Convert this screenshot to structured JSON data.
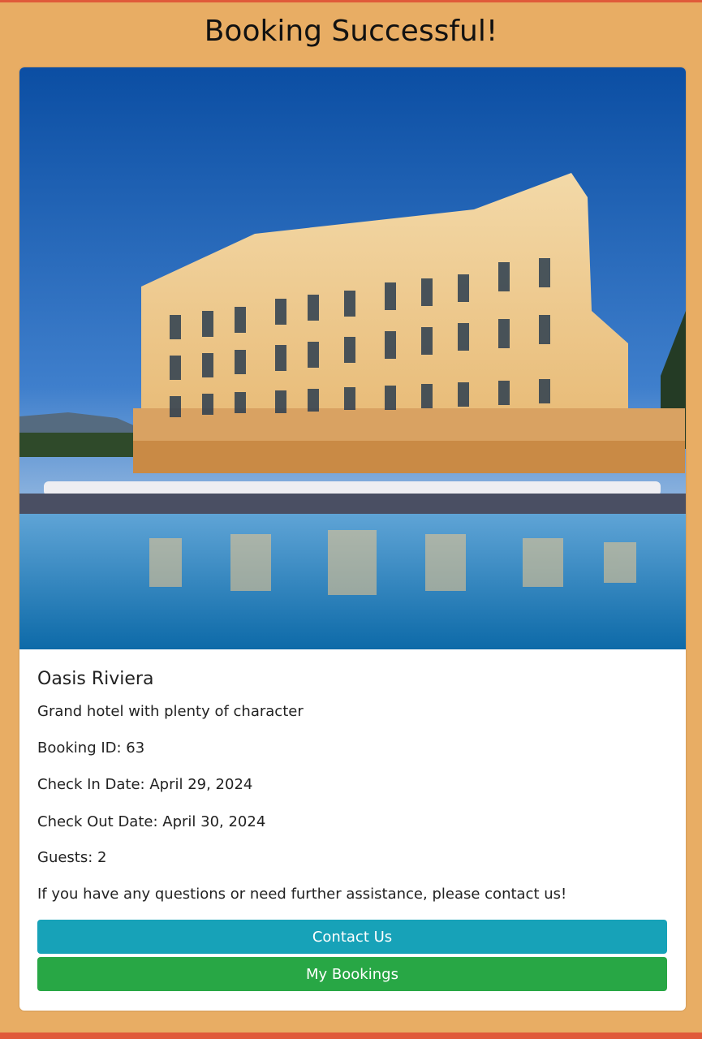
{
  "page": {
    "title": "Booking Successful!"
  },
  "hotel": {
    "name": "Oasis Riviera",
    "description": "Grand hotel with plenty of character",
    "image_alt": "hotel-photo"
  },
  "booking": {
    "id_text": "Booking ID: 63",
    "check_in_text": "Check In Date: April 29, 2024",
    "check_out_text": "Check Out Date: April 30, 2024",
    "guests_text": "Guests: 2"
  },
  "message": "If you have any questions or need further assistance, please contact us!",
  "actions": {
    "contact_label": "Contact Us",
    "bookings_label": "My Bookings"
  },
  "colors": {
    "background": "#e8ad64",
    "accent_bar": "#e05a3a",
    "contact_button": "#17a2b8",
    "bookings_button": "#28a745"
  }
}
